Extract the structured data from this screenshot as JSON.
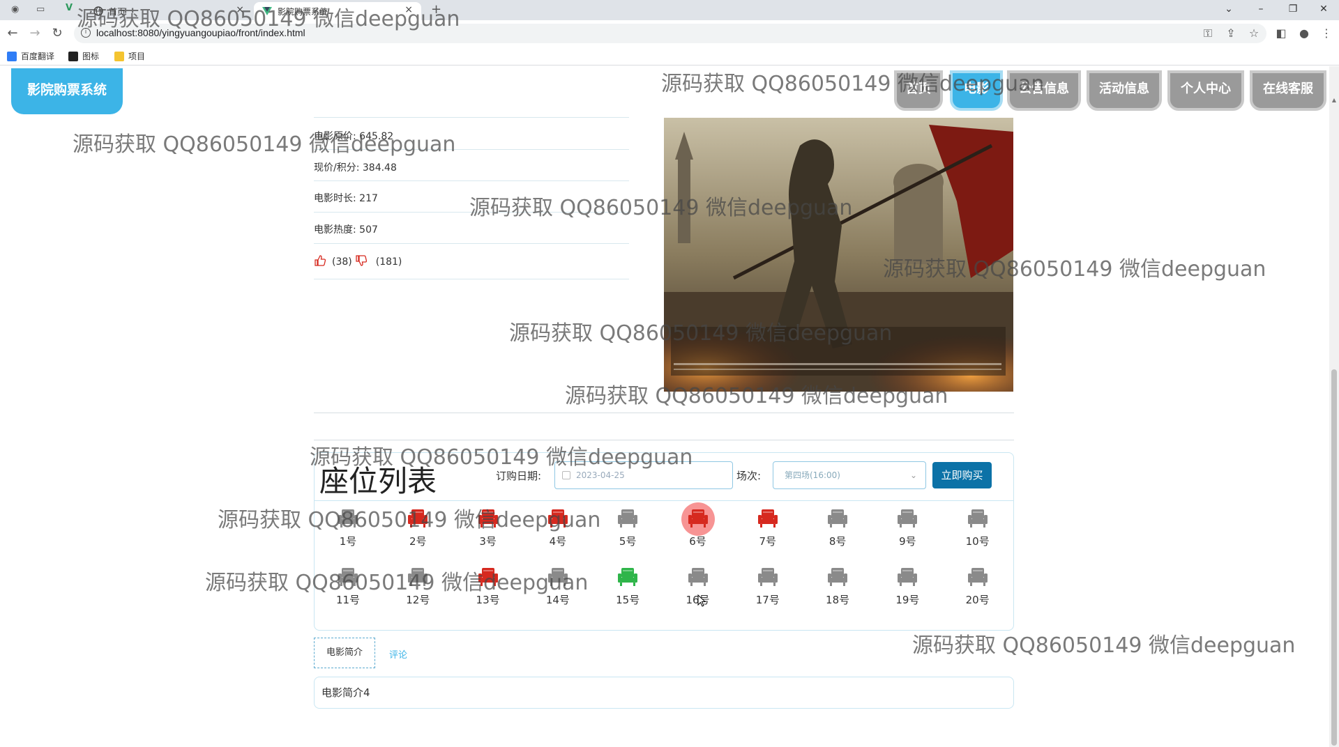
{
  "browser": {
    "tabs": [
      {
        "title": "首页"
      },
      {
        "title": "影院购票系统"
      }
    ],
    "new_tab": "+",
    "url": "localhost:8080/yingyuangoupiao/front/index.html",
    "bookmarks": [
      {
        "label": "百度翻译",
        "icon": "baidu-translate-icon"
      },
      {
        "label": "图标",
        "icon": "image-icon"
      },
      {
        "label": "项目",
        "icon": "folder-icon"
      }
    ]
  },
  "site": {
    "logo": "影院购票系统",
    "nav": [
      {
        "label": "首页",
        "active": false
      },
      {
        "label": "电影",
        "active": true
      },
      {
        "label": "公告信息",
        "active": false
      },
      {
        "label": "活动信息",
        "active": false
      },
      {
        "label": "个人中心",
        "active": false
      },
      {
        "label": "在线客服",
        "active": false
      }
    ]
  },
  "movie": {
    "original_price": "电影原价: 645.82",
    "current_price": "现价/积分: 384.48",
    "duration": "电影时长: 217",
    "heat": "电影热度: 507",
    "likes": "(38)",
    "dislikes": "(181)"
  },
  "seats": {
    "title": "座位列表",
    "date_label": "订购日期:",
    "date_value": "2023-04-25",
    "session_label": "场次:",
    "session_value": "第四场(16:00)",
    "buy_label": "立即购买",
    "row1": [
      {
        "label": "1号",
        "state": "available"
      },
      {
        "label": "2号",
        "state": "sold"
      },
      {
        "label": "3号",
        "state": "sold"
      },
      {
        "label": "4号",
        "state": "sold"
      },
      {
        "label": "5号",
        "state": "available"
      },
      {
        "label": "6号",
        "state": "sold"
      },
      {
        "label": "7号",
        "state": "sold"
      },
      {
        "label": "8号",
        "state": "available"
      },
      {
        "label": "9号",
        "state": "available"
      },
      {
        "label": "10号",
        "state": "available"
      }
    ],
    "row2": [
      {
        "label": "11号",
        "state": "available"
      },
      {
        "label": "12号",
        "state": "available"
      },
      {
        "label": "13号",
        "state": "sold"
      },
      {
        "label": "14号",
        "state": "available"
      },
      {
        "label": "15号",
        "state": "selected"
      },
      {
        "label": "16号",
        "state": "available"
      },
      {
        "label": "17号",
        "state": "available"
      },
      {
        "label": "18号",
        "state": "available"
      },
      {
        "label": "19号",
        "state": "available"
      },
      {
        "label": "20号",
        "state": "available"
      }
    ],
    "colors": {
      "available": "#8a8a8a",
      "sold": "#d6291f",
      "selected": "#2fb54a"
    }
  },
  "detail_tabs": {
    "intro": "电影简介",
    "comment": "评论",
    "intro_text": "电影简介4"
  },
  "watermark": "源码获取 QQ86050149 微信deepguan"
}
